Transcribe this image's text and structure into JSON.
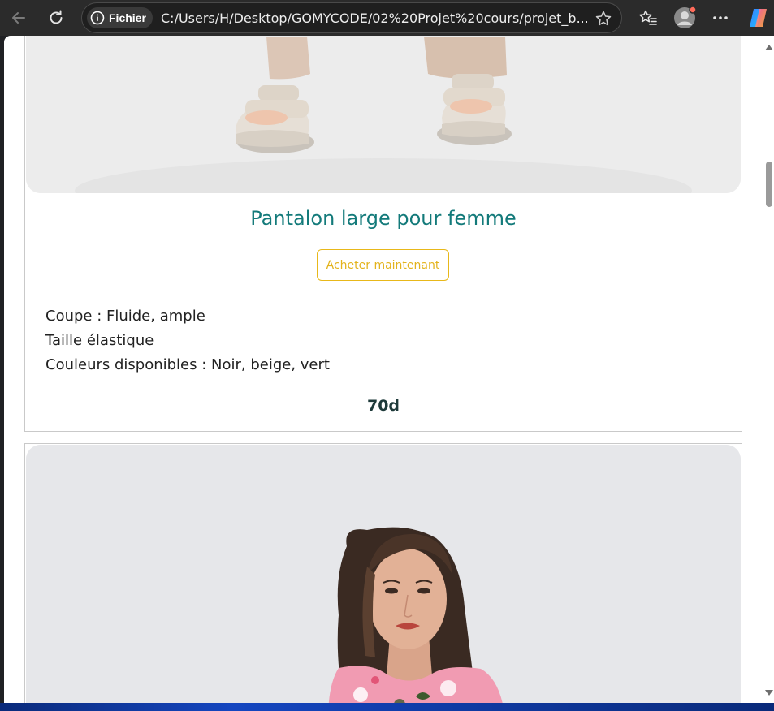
{
  "browser": {
    "site_info_label": "Fichier",
    "url": "C:/Users/H/Desktop/GOMYCODE/02%20Projet%20cours/projet_b..."
  },
  "product": {
    "title": "Pantalon large pour femme",
    "buy_label": "Acheter maintenant",
    "details": [
      "Coupe : Fluide, ample",
      "Taille élastique",
      "Couleurs disponibles : Noir, beige, vert"
    ],
    "price": "70d"
  },
  "colors": {
    "title": "#137a7a",
    "button_accent": "#e8b81a",
    "price": "#1e3a3a"
  },
  "icons": {
    "back": "arrow-left-icon",
    "reload": "reload-icon",
    "site_info": "info-icon",
    "favorite": "star-icon",
    "favorites_list": "favorites-icon",
    "profile": "profile-icon",
    "menu": "more-icon",
    "copilot": "copilot-icon"
  }
}
